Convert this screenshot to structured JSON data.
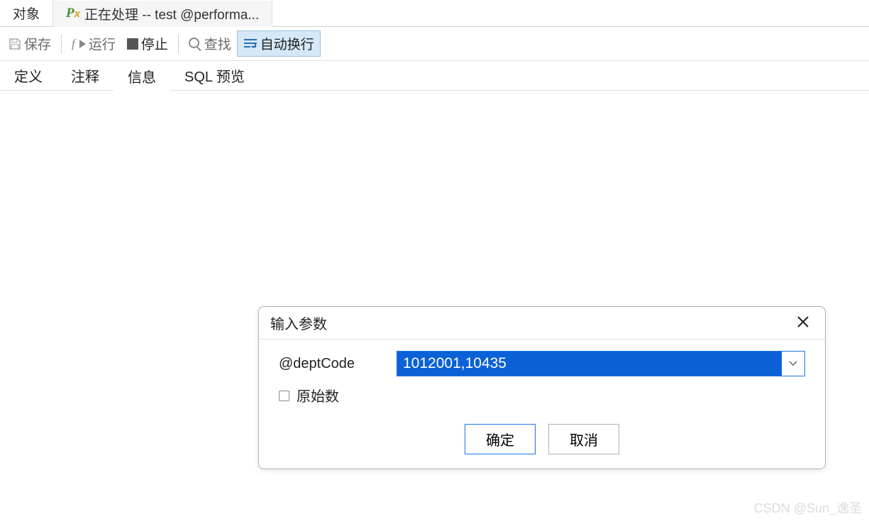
{
  "tabs": {
    "object": "对象",
    "processing": "正在处理 -- test @performa..."
  },
  "toolbar": {
    "save": "保存",
    "run": "运行",
    "stop": "停止",
    "find": "查找",
    "wrap": "自动换行"
  },
  "subtabs": {
    "definition": "定义",
    "comment": "注释",
    "info": "信息",
    "sqlpreview": "SQL 预览"
  },
  "dialog": {
    "title": "输入参数",
    "param_label": "@deptCode",
    "param_value": "1012001,10435",
    "raw_checkbox": "原始数",
    "ok": "确定",
    "cancel": "取消"
  },
  "watermark": "CSDN @Sun_逸圣"
}
